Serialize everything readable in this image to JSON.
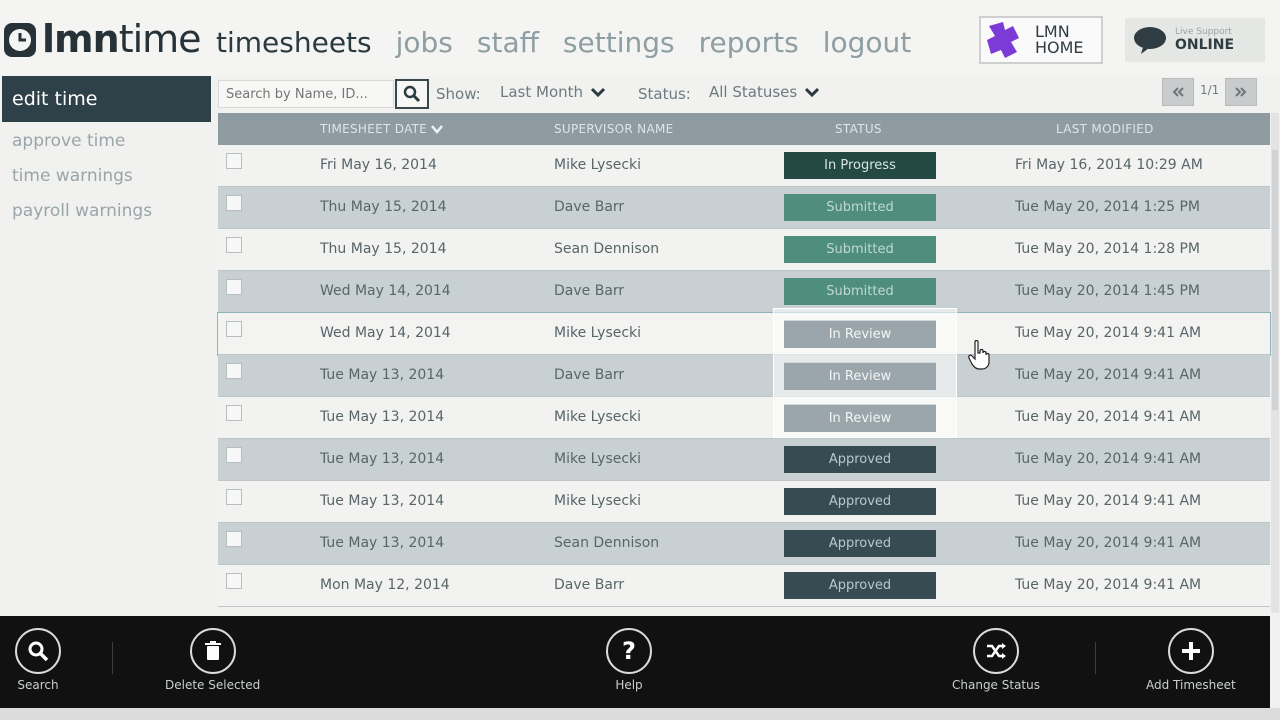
{
  "app": {
    "logo_bold": "lmn",
    "logo_light": "time"
  },
  "nav": [
    "timesheets",
    "jobs",
    "staff",
    "settings",
    "reports",
    "logout"
  ],
  "lmn_home": {
    "line1": "LMN",
    "line2": "HOME"
  },
  "live_support": {
    "small": "Live Support",
    "status": "ONLINE"
  },
  "sidebar": {
    "active": "edit time",
    "items": [
      "approve time",
      "time warnings",
      "payroll warnings"
    ]
  },
  "filter": {
    "search_placeholder": "Search by Name, ID...",
    "show_label": "Show:",
    "show_value": "Last Month",
    "status_label": "Status:",
    "status_value": "All Statuses",
    "page": "1/1"
  },
  "table": {
    "headers": [
      "TIMESHEET DATE",
      "SUPERVISOR NAME",
      "STATUS",
      "LAST MODIFIED"
    ],
    "rows": [
      {
        "date": "Fri May 16, 2014",
        "supervisor": "Mike Lysecki",
        "status": "In Progress",
        "modified": "Fri May 16, 2014 10:29 AM"
      },
      {
        "date": "Thu May 15, 2014",
        "supervisor": "Dave Barr",
        "status": "Submitted",
        "modified": "Tue May 20, 2014 1:25 PM"
      },
      {
        "date": "Thu May 15, 2014",
        "supervisor": "Sean Dennison",
        "status": "Submitted",
        "modified": "Tue May 20, 2014 1:28 PM"
      },
      {
        "date": "Wed May 14, 2014",
        "supervisor": "Dave Barr",
        "status": "Submitted",
        "modified": "Tue May 20, 2014 1:45 PM"
      },
      {
        "date": "Wed May 14, 2014",
        "supervisor": "Mike Lysecki",
        "status": "In Review",
        "modified": "Tue May 20, 2014 9:41 AM"
      },
      {
        "date": "Tue May 13, 2014",
        "supervisor": "Dave Barr",
        "status": "In Review",
        "modified": "Tue May 20, 2014 9:41 AM"
      },
      {
        "date": "Tue May 13, 2014",
        "supervisor": "Mike Lysecki",
        "status": "In Review",
        "modified": "Tue May 20, 2014 9:41 AM"
      },
      {
        "date": "Tue May 13, 2014",
        "supervisor": "Mike Lysecki",
        "status": "Approved",
        "modified": "Tue May 20, 2014 9:41 AM"
      },
      {
        "date": "Tue May 13, 2014",
        "supervisor": "Mike Lysecki",
        "status": "Approved",
        "modified": "Tue May 20, 2014 9:41 AM"
      },
      {
        "date": "Tue May 13, 2014",
        "supervisor": "Sean Dennison",
        "status": "Approved",
        "modified": "Tue May 20, 2014 9:41 AM"
      },
      {
        "date": "Mon May 12, 2014",
        "supervisor": "Dave Barr",
        "status": "Approved",
        "modified": "Tue May 20, 2014 9:41 AM"
      }
    ]
  },
  "toolbar": {
    "search": "Search",
    "delete": "Delete Selected",
    "help": "Help",
    "change_status": "Change Status",
    "add": "Add Timesheet"
  },
  "colors": {
    "in_progress": "#244843",
    "submitted": "#4f8d7d",
    "in_review": "#9aa6ab",
    "approved": "#374b53"
  }
}
